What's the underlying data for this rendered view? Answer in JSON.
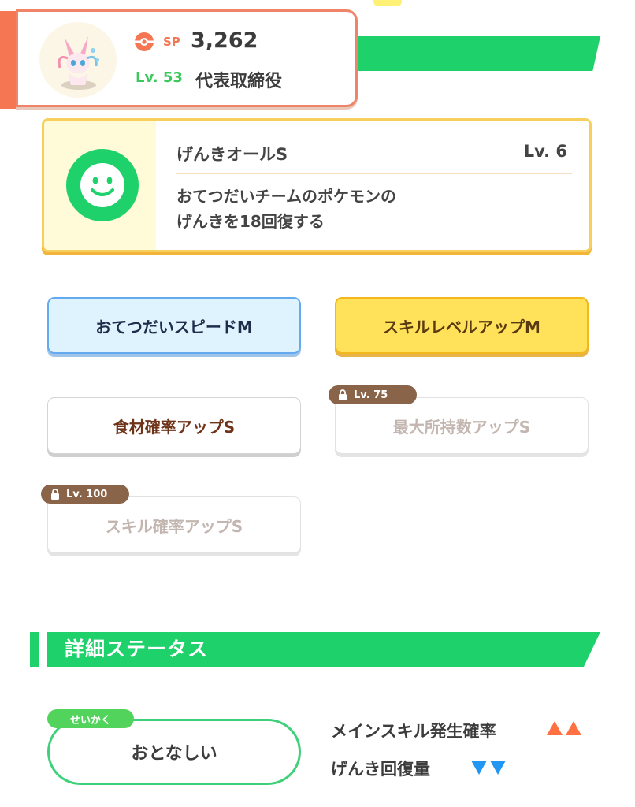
{
  "pokemon": {
    "sp_label": "SP",
    "sp_value": "3,262",
    "level": "Lv. 53",
    "role": "代表取締役",
    "accent_color": "#f47653"
  },
  "main_skill": {
    "name": "げんきオールS",
    "level": "Lv. 6",
    "description": "おてつだいチームのポケモンの\nげんきを18回復する",
    "icon": "smile-icon"
  },
  "sub_skills": [
    {
      "label": "おてつだいスピードM",
      "style": "blue"
    },
    {
      "label": "スキルレベルアップM",
      "style": "gold"
    },
    {
      "label": "食材確率アップS",
      "style": "white"
    },
    {
      "label": "最大所持数アップS",
      "style": "locked",
      "unlock_level": "Lv. 75"
    },
    {
      "label": "スキル確率アップS",
      "style": "locked",
      "unlock_level": "Lv. 100"
    }
  ],
  "detail_status": {
    "title": "詳細ステータス",
    "nature_tag": "せいかく",
    "nature": "おとなしい",
    "up_effect": {
      "label": "メインスキル発生確率",
      "icon": "up-arrows-icon",
      "color": "#ff7043"
    },
    "down_effect": {
      "label": "げんき回復量",
      "icon": "down-arrows-icon",
      "color": "#2196f3"
    }
  }
}
